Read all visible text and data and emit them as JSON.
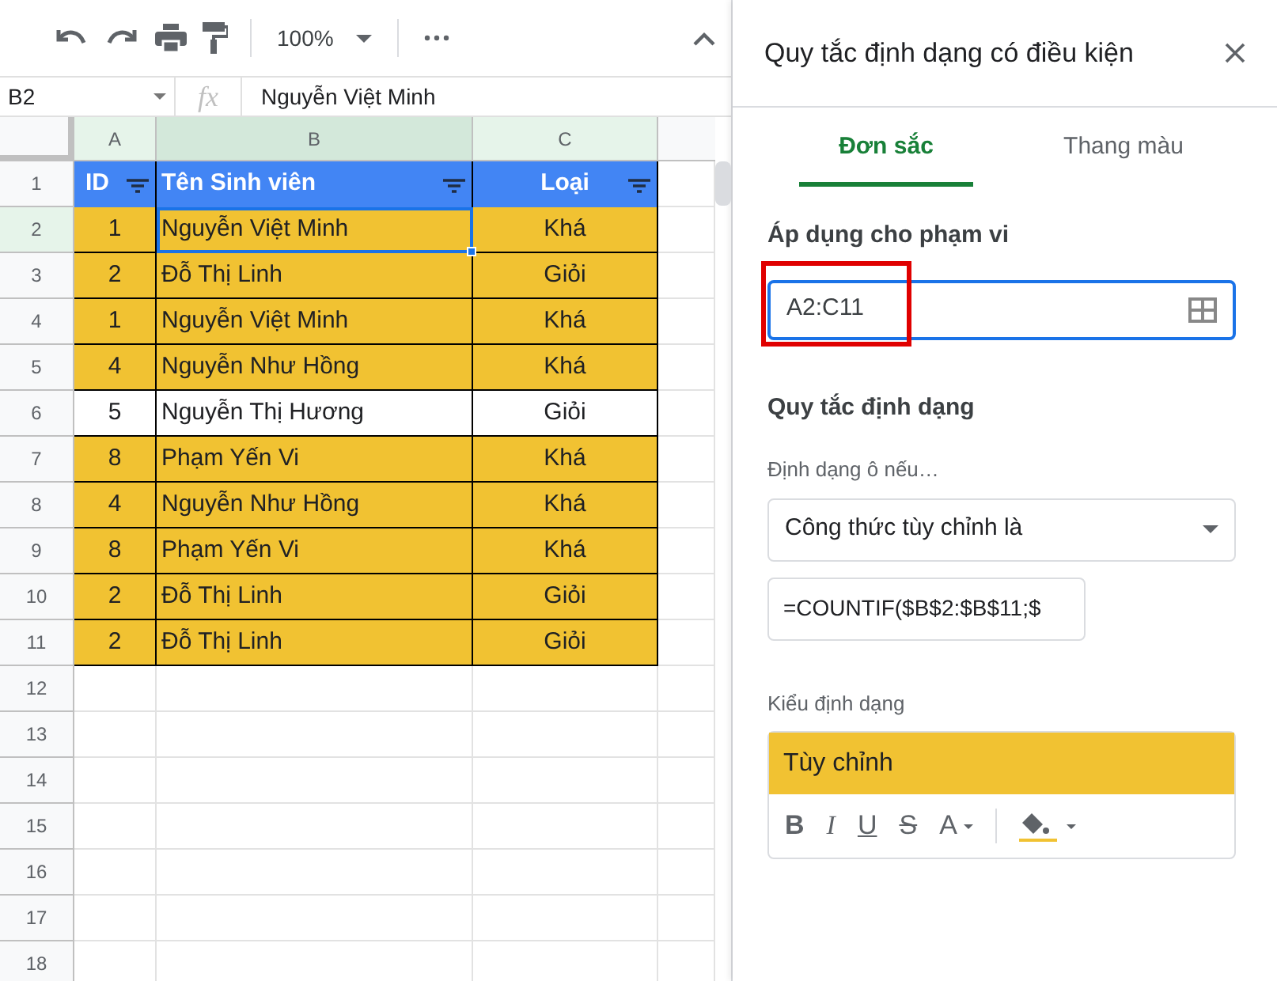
{
  "toolbar": {
    "zoom": "100%"
  },
  "formula_bar": {
    "cell_ref": "B2",
    "fx_label": "fx",
    "value": "Nguyễn Việt Minh"
  },
  "sheet": {
    "row_header": [
      "1",
      "2",
      "3",
      "4",
      "5",
      "6",
      "7",
      "8",
      "9",
      "10",
      "11",
      "12",
      "13",
      "14",
      "15",
      "16",
      "17",
      "18"
    ],
    "columns": [
      {
        "label": "A",
        "selected": false
      },
      {
        "label": "B",
        "selected": true
      },
      {
        "label": "C",
        "selected": false
      }
    ],
    "header": [
      "ID",
      "Tên Sinh viên",
      "Loại"
    ],
    "rows": [
      {
        "cells": [
          "1",
          "Nguyễn Việt Minh",
          "Khá"
        ],
        "highlighted": true,
        "selected": true
      },
      {
        "cells": [
          "2",
          "Đỗ Thị Linh",
          "Giỏi"
        ],
        "highlighted": true,
        "selected": false
      },
      {
        "cells": [
          "1",
          "Nguyễn Việt Minh",
          "Khá"
        ],
        "highlighted": true,
        "selected": false
      },
      {
        "cells": [
          "4",
          "Nguyễn Như Hồng",
          "Khá"
        ],
        "highlighted": true,
        "selected": false
      },
      {
        "cells": [
          "5",
          "Nguyễn Thị Hương",
          "Giỏi"
        ],
        "highlighted": false,
        "selected": false
      },
      {
        "cells": [
          "8",
          "Phạm Yến Vi",
          "Khá"
        ],
        "highlighted": true,
        "selected": false
      },
      {
        "cells": [
          "4",
          "Nguyễn Như Hồng",
          "Khá"
        ],
        "highlighted": true,
        "selected": false
      },
      {
        "cells": [
          "8",
          "Phạm Yến Vi",
          "Khá"
        ],
        "highlighted": true,
        "selected": false
      },
      {
        "cells": [
          "2",
          "Đỗ Thị Linh",
          "Giỏi"
        ],
        "highlighted": true,
        "selected": false
      },
      {
        "cells": [
          "2",
          "Đỗ Thị Linh",
          "Giỏi"
        ],
        "highlighted": true,
        "selected": false
      }
    ]
  },
  "panel": {
    "title": "Quy tắc định dạng có điều kiện",
    "tabs": [
      {
        "label": "Đơn sắc",
        "selected": true
      },
      {
        "label": "Thang màu",
        "selected": false
      }
    ],
    "range_label": "Áp dụng cho phạm vi",
    "range_value": "A2:C11",
    "rules_heading": "Quy tắc định dạng",
    "condition_label": "Định dạng ô nếu…",
    "condition_value": "Công thức tùy chỉnh là",
    "formula_value": "=COUNTIF($B$2:$B$11;$",
    "style_label": "Kiểu định dạng",
    "style_preview": "Tùy chỉnh",
    "format_buttons": [
      {
        "label": "B",
        "kind": "bold"
      },
      {
        "label": "I",
        "kind": "italic"
      },
      {
        "label": "U",
        "kind": "underline"
      },
      {
        "label": "S",
        "kind": "strike"
      },
      {
        "label": "A",
        "kind": "color"
      }
    ]
  }
}
